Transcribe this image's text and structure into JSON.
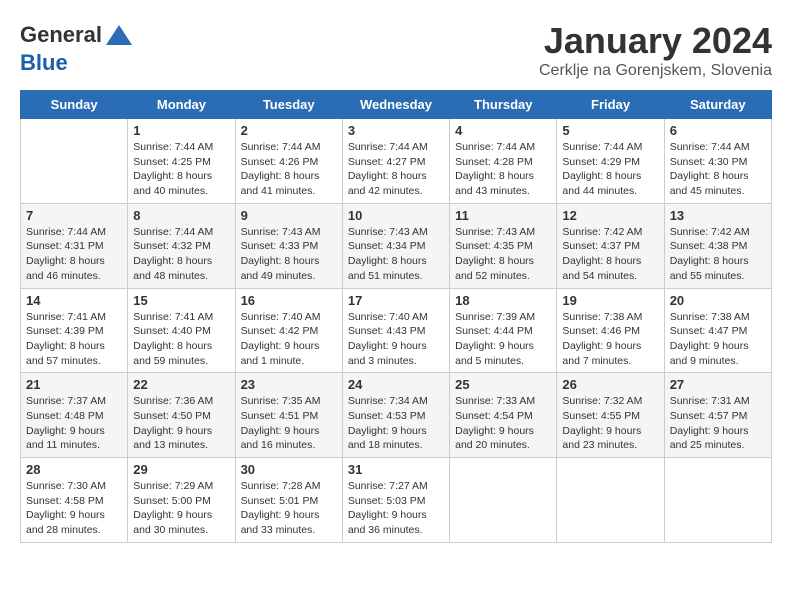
{
  "logo": {
    "general": "General",
    "blue": "Blue"
  },
  "header": {
    "month_title": "January 2024",
    "subtitle": "Cerklje na Gorenjskem, Slovenia"
  },
  "days_of_week": [
    "Sunday",
    "Monday",
    "Tuesday",
    "Wednesday",
    "Thursday",
    "Friday",
    "Saturday"
  ],
  "weeks": [
    [
      {
        "day": "",
        "sunrise": "",
        "sunset": "",
        "daylight": ""
      },
      {
        "day": "1",
        "sunrise": "Sunrise: 7:44 AM",
        "sunset": "Sunset: 4:25 PM",
        "daylight": "Daylight: 8 hours and 40 minutes."
      },
      {
        "day": "2",
        "sunrise": "Sunrise: 7:44 AM",
        "sunset": "Sunset: 4:26 PM",
        "daylight": "Daylight: 8 hours and 41 minutes."
      },
      {
        "day": "3",
        "sunrise": "Sunrise: 7:44 AM",
        "sunset": "Sunset: 4:27 PM",
        "daylight": "Daylight: 8 hours and 42 minutes."
      },
      {
        "day": "4",
        "sunrise": "Sunrise: 7:44 AM",
        "sunset": "Sunset: 4:28 PM",
        "daylight": "Daylight: 8 hours and 43 minutes."
      },
      {
        "day": "5",
        "sunrise": "Sunrise: 7:44 AM",
        "sunset": "Sunset: 4:29 PM",
        "daylight": "Daylight: 8 hours and 44 minutes."
      },
      {
        "day": "6",
        "sunrise": "Sunrise: 7:44 AM",
        "sunset": "Sunset: 4:30 PM",
        "daylight": "Daylight: 8 hours and 45 minutes."
      }
    ],
    [
      {
        "day": "7",
        "sunrise": "Sunrise: 7:44 AM",
        "sunset": "Sunset: 4:31 PM",
        "daylight": "Daylight: 8 hours and 46 minutes."
      },
      {
        "day": "8",
        "sunrise": "Sunrise: 7:44 AM",
        "sunset": "Sunset: 4:32 PM",
        "daylight": "Daylight: 8 hours and 48 minutes."
      },
      {
        "day": "9",
        "sunrise": "Sunrise: 7:43 AM",
        "sunset": "Sunset: 4:33 PM",
        "daylight": "Daylight: 8 hours and 49 minutes."
      },
      {
        "day": "10",
        "sunrise": "Sunrise: 7:43 AM",
        "sunset": "Sunset: 4:34 PM",
        "daylight": "Daylight: 8 hours and 51 minutes."
      },
      {
        "day": "11",
        "sunrise": "Sunrise: 7:43 AM",
        "sunset": "Sunset: 4:35 PM",
        "daylight": "Daylight: 8 hours and 52 minutes."
      },
      {
        "day": "12",
        "sunrise": "Sunrise: 7:42 AM",
        "sunset": "Sunset: 4:37 PM",
        "daylight": "Daylight: 8 hours and 54 minutes."
      },
      {
        "day": "13",
        "sunrise": "Sunrise: 7:42 AM",
        "sunset": "Sunset: 4:38 PM",
        "daylight": "Daylight: 8 hours and 55 minutes."
      }
    ],
    [
      {
        "day": "14",
        "sunrise": "Sunrise: 7:41 AM",
        "sunset": "Sunset: 4:39 PM",
        "daylight": "Daylight: 8 hours and 57 minutes."
      },
      {
        "day": "15",
        "sunrise": "Sunrise: 7:41 AM",
        "sunset": "Sunset: 4:40 PM",
        "daylight": "Daylight: 8 hours and 59 minutes."
      },
      {
        "day": "16",
        "sunrise": "Sunrise: 7:40 AM",
        "sunset": "Sunset: 4:42 PM",
        "daylight": "Daylight: 9 hours and 1 minute."
      },
      {
        "day": "17",
        "sunrise": "Sunrise: 7:40 AM",
        "sunset": "Sunset: 4:43 PM",
        "daylight": "Daylight: 9 hours and 3 minutes."
      },
      {
        "day": "18",
        "sunrise": "Sunrise: 7:39 AM",
        "sunset": "Sunset: 4:44 PM",
        "daylight": "Daylight: 9 hours and 5 minutes."
      },
      {
        "day": "19",
        "sunrise": "Sunrise: 7:38 AM",
        "sunset": "Sunset: 4:46 PM",
        "daylight": "Daylight: 9 hours and 7 minutes."
      },
      {
        "day": "20",
        "sunrise": "Sunrise: 7:38 AM",
        "sunset": "Sunset: 4:47 PM",
        "daylight": "Daylight: 9 hours and 9 minutes."
      }
    ],
    [
      {
        "day": "21",
        "sunrise": "Sunrise: 7:37 AM",
        "sunset": "Sunset: 4:48 PM",
        "daylight": "Daylight: 9 hours and 11 minutes."
      },
      {
        "day": "22",
        "sunrise": "Sunrise: 7:36 AM",
        "sunset": "Sunset: 4:50 PM",
        "daylight": "Daylight: 9 hours and 13 minutes."
      },
      {
        "day": "23",
        "sunrise": "Sunrise: 7:35 AM",
        "sunset": "Sunset: 4:51 PM",
        "daylight": "Daylight: 9 hours and 16 minutes."
      },
      {
        "day": "24",
        "sunrise": "Sunrise: 7:34 AM",
        "sunset": "Sunset: 4:53 PM",
        "daylight": "Daylight: 9 hours and 18 minutes."
      },
      {
        "day": "25",
        "sunrise": "Sunrise: 7:33 AM",
        "sunset": "Sunset: 4:54 PM",
        "daylight": "Daylight: 9 hours and 20 minutes."
      },
      {
        "day": "26",
        "sunrise": "Sunrise: 7:32 AM",
        "sunset": "Sunset: 4:55 PM",
        "daylight": "Daylight: 9 hours and 23 minutes."
      },
      {
        "day": "27",
        "sunrise": "Sunrise: 7:31 AM",
        "sunset": "Sunset: 4:57 PM",
        "daylight": "Daylight: 9 hours and 25 minutes."
      }
    ],
    [
      {
        "day": "28",
        "sunrise": "Sunrise: 7:30 AM",
        "sunset": "Sunset: 4:58 PM",
        "daylight": "Daylight: 9 hours and 28 minutes."
      },
      {
        "day": "29",
        "sunrise": "Sunrise: 7:29 AM",
        "sunset": "Sunset: 5:00 PM",
        "daylight": "Daylight: 9 hours and 30 minutes."
      },
      {
        "day": "30",
        "sunrise": "Sunrise: 7:28 AM",
        "sunset": "Sunset: 5:01 PM",
        "daylight": "Daylight: 9 hours and 33 minutes."
      },
      {
        "day": "31",
        "sunrise": "Sunrise: 7:27 AM",
        "sunset": "Sunset: 5:03 PM",
        "daylight": "Daylight: 9 hours and 36 minutes."
      },
      {
        "day": "",
        "sunrise": "",
        "sunset": "",
        "daylight": ""
      },
      {
        "day": "",
        "sunrise": "",
        "sunset": "",
        "daylight": ""
      },
      {
        "day": "",
        "sunrise": "",
        "sunset": "",
        "daylight": ""
      }
    ]
  ]
}
